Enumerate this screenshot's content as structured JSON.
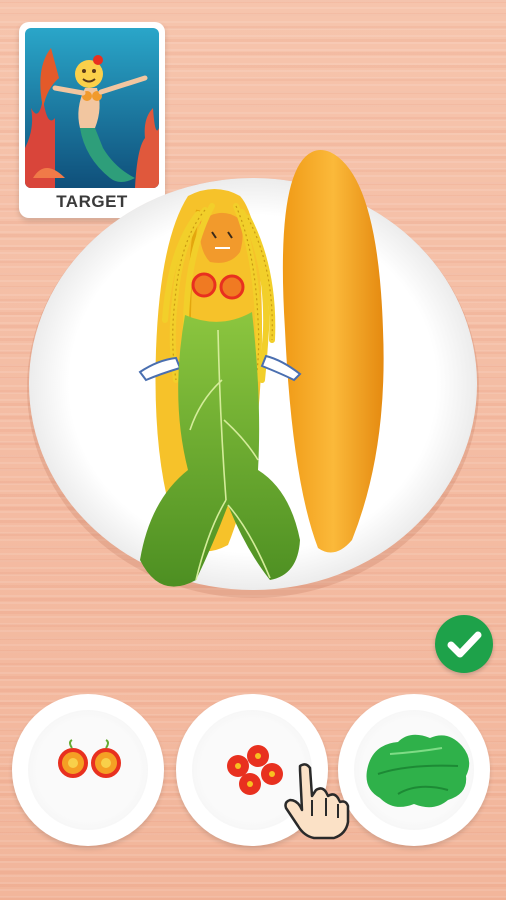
{
  "target": {
    "label": "TARGET"
  },
  "ingredients": [
    {
      "name": "tomato-slices"
    },
    {
      "name": "cherry-tomatoes"
    },
    {
      "name": "lettuce-leaves"
    }
  ],
  "colors": {
    "plate": "#ffffff",
    "mango": "#f6a623",
    "hair": "#f2cf2a",
    "leaf": "#6fae2f",
    "check": "#1ea24a",
    "tomato": "#e8301f"
  }
}
